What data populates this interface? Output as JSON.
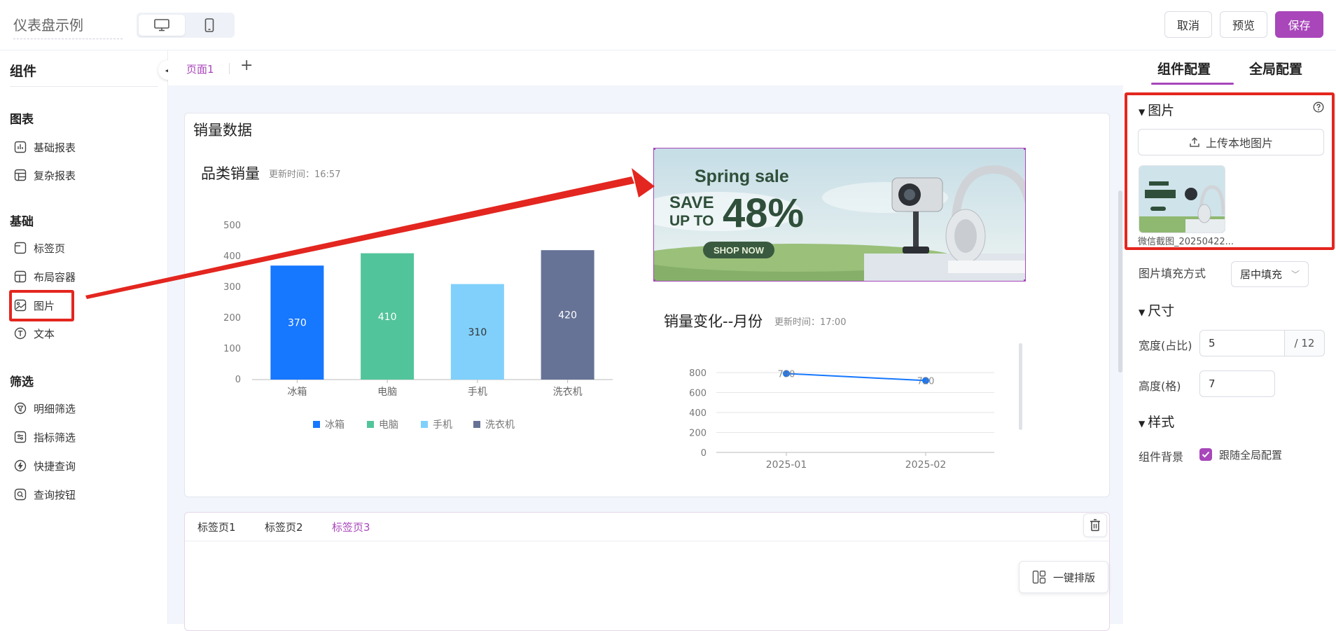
{
  "app": {
    "title": "仪表盘示例"
  },
  "header": {
    "cancel": "取消",
    "preview": "预览",
    "save": "保存"
  },
  "leftpanel": {
    "title": "组件",
    "groups": [
      {
        "label": "图表",
        "items": [
          "基础报表",
          "复杂报表"
        ]
      },
      {
        "label": "基础",
        "items": [
          "标签页",
          "布局容器",
          "图片",
          "文本"
        ]
      },
      {
        "label": "筛选",
        "items": [
          "明细筛选",
          "指标筛选",
          "快捷查询",
          "查询按钮"
        ]
      }
    ]
  },
  "page": {
    "tab": "页面1",
    "add": "+"
  },
  "card": {
    "title": "销量数据"
  },
  "chart_data": [
    {
      "type": "bar",
      "title": "品类销量",
      "subtitle": "更新时间：16:57",
      "categories": [
        "冰箱",
        "电脑",
        "手机",
        "洗衣机"
      ],
      "values": [
        370,
        410,
        310,
        420
      ],
      "data_labels": [
        "370",
        "410",
        "310",
        "420"
      ],
      "legend": [
        "冰箱",
        "电脑",
        "手机",
        "洗衣机"
      ],
      "yticks": [
        "500",
        "400",
        "300",
        "200",
        "100",
        "0"
      ],
      "ylim": [
        0,
        500
      ],
      "colors": [
        "#1677ff",
        "#52c49b",
        "#80d0fb",
        "#667396"
      ],
      "legend_position": "bottom",
      "grid": false
    },
    {
      "type": "line",
      "title": "销量变化--月份",
      "subtitle": "更新时间：17:00",
      "x": [
        "2025-01",
        "2025-02"
      ],
      "values": [
        790,
        720
      ],
      "data_labels": [
        "790",
        "720"
      ],
      "yticks": [
        "800",
        "600",
        "400",
        "200",
        "0"
      ],
      "ylim": [
        0,
        800
      ],
      "color": "#1677ff",
      "grid": true
    }
  ],
  "banner": {
    "line1": "Spring sale",
    "line2a": "SAVE",
    "line2b": "UP TO",
    "pct": "48%",
    "cta": "SHOP NOW"
  },
  "tabs2": [
    "标签页1",
    "标签页2",
    "标签页3"
  ],
  "autolayout": "一键排版",
  "rightpanel": {
    "tab_component": "组件配置",
    "tab_global": "全局配置",
    "section_image": "图片",
    "upload": "上传本地图片",
    "thumb_name": "微信截图_20250422...",
    "fill_label": "图片填充方式",
    "fill_value": "居中填充",
    "section_size": "尺寸",
    "width_label": "宽度(占比)",
    "width_value": "5",
    "width_suffix": "/ 12",
    "height_label": "高度(格)",
    "height_value": "7",
    "section_style": "样式",
    "bg_label": "组件背景",
    "bg_value": "跟随全局配置"
  },
  "colors": {
    "accent": "#a846ba",
    "annotation": "#e3261f"
  }
}
